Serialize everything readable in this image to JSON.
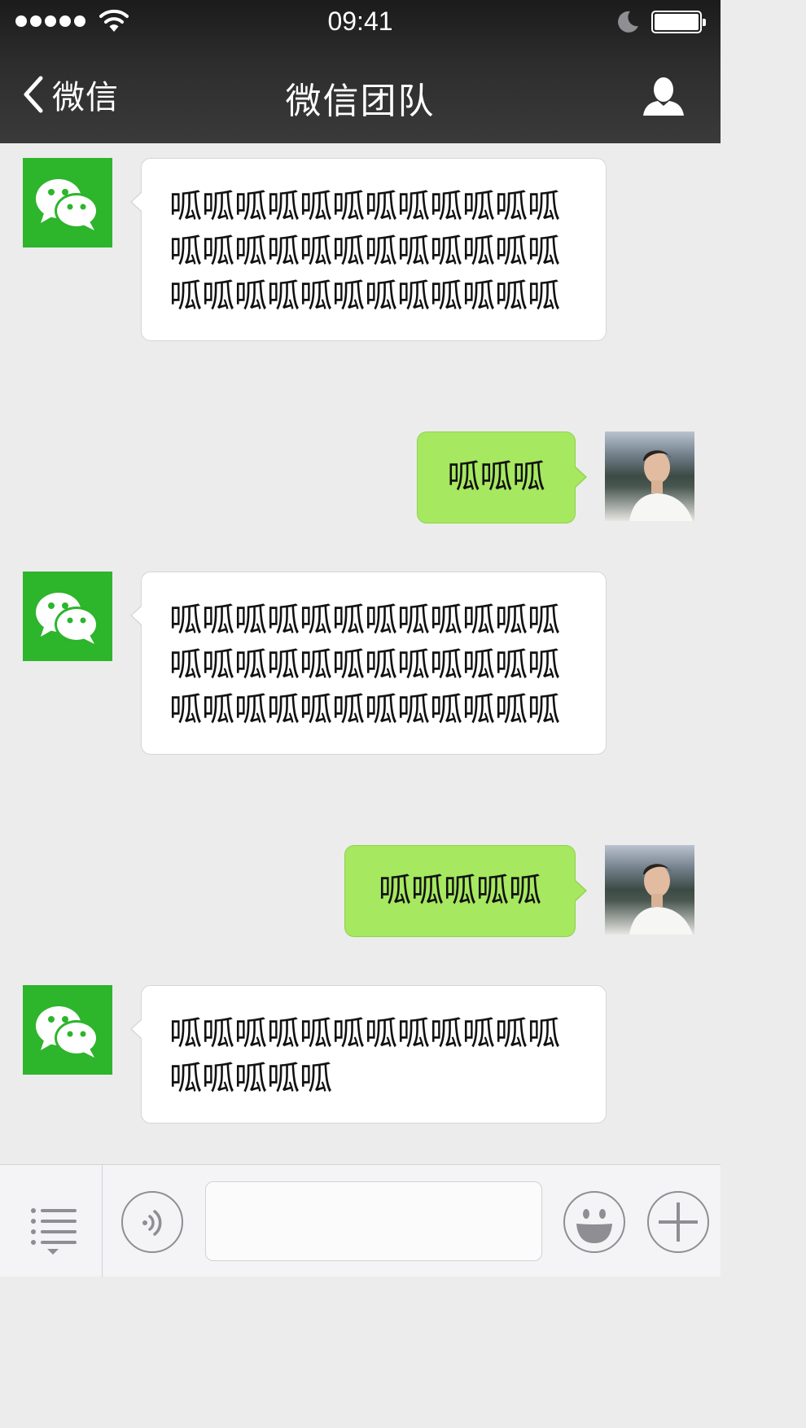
{
  "status_bar": {
    "time": "09:41",
    "signal_icon": "signal-dots-icon",
    "wifi_icon": "wifi-icon",
    "do_not_disturb_icon": "moon-icon",
    "battery_icon": "battery-icon",
    "battery_level": 1.0
  },
  "nav": {
    "back_icon": "chevron-left-icon",
    "back_label": "微信",
    "title": "微信团队",
    "profile_icon": "person-icon"
  },
  "colors": {
    "header": "#2b2b2b",
    "chat_background": "#ececec",
    "outgoing_bubble": "#a6e860",
    "incoming_bubble": "#ffffff",
    "wechat_green": "#2db52c"
  },
  "messages": [
    {
      "side": "in",
      "avatar": "wechat-logo-icon",
      "text": "呱呱呱呱呱呱呱呱呱呱呱呱呱呱呱呱呱呱呱呱呱呱呱呱呱呱呱呱呱呱呱呱呱呱呱呱"
    },
    {
      "side": "out",
      "avatar": "user-photo",
      "text": "呱呱呱"
    },
    {
      "side": "in",
      "avatar": "wechat-logo-icon",
      "text": "呱呱呱呱呱呱呱呱呱呱呱呱呱呱呱呱呱呱呱呱呱呱呱呱呱呱呱呱呱呱呱呱呱呱呱呱"
    },
    {
      "side": "out",
      "avatar": "user-photo",
      "text": "呱呱呱呱呱"
    },
    {
      "side": "in",
      "avatar": "wechat-logo-icon",
      "text": "呱呱呱呱呱呱呱呱呱呱呱呱呱呱呱呱呱"
    }
  ],
  "input_bar": {
    "menu_icon": "list-menu-icon",
    "voice_icon": "voice-icon",
    "message_value": "",
    "emoji_icon": "smiley-icon",
    "plus_icon": "plus-icon"
  }
}
